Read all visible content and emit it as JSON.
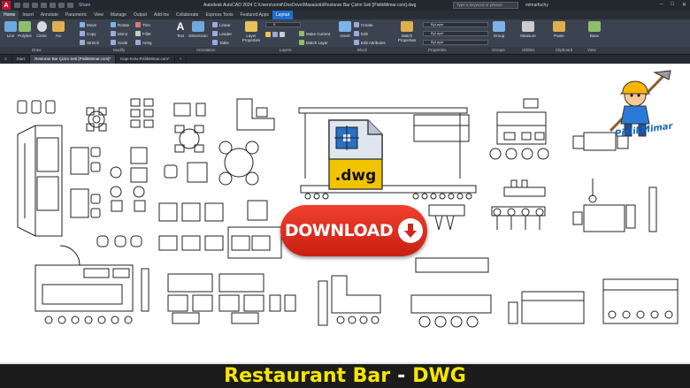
{
  "titlebar": {
    "app_letter": "A",
    "share": "Share",
    "title": "Autodesk AutoCAD 2024    C:\\Users\\cemil\\OneDrive\\Masaüstü\\Restoran Bar Çizim Seti [PislikMimar.com].dwg",
    "search_placeholder": "Type a keyword or phrase",
    "user": "mimarfuchy"
  },
  "tabs": [
    "Home",
    "Insert",
    "Annotate",
    "Parametric",
    "View",
    "Manage",
    "Output",
    "Add-ins",
    "Collaborate",
    "Express Tools",
    "Featured Apps",
    "Layout"
  ],
  "ribbon": {
    "draw": [
      "Line",
      "Polyline",
      "Circle",
      "Arc"
    ],
    "modify": [
      "Move",
      "Rotate",
      "Trim",
      "Copy",
      "Mirror",
      "Fillet",
      "Stretch",
      "Scale",
      "Array"
    ],
    "annotation": [
      "Text",
      "Dimension",
      "Linear",
      "Leader",
      "Table"
    ],
    "layers": [
      "Layer Properties",
      "Make Current",
      "Match Layer"
    ],
    "block": [
      "Insert",
      "Create",
      "Edit",
      "Edit Attributes"
    ],
    "properties": [
      "Match Properties",
      "ByLayer",
      "ByLayer",
      "ByLayer"
    ],
    "groups": "Group",
    "utilities": "Measure",
    "clipboard": "Paste",
    "view": "Base",
    "panel_labels": [
      "Draw",
      "Modify",
      "Annotation",
      "Layers",
      "Block",
      "Properties",
      "Groups",
      "Utilities",
      "Clipboard",
      "View"
    ]
  },
  "filetabs": {
    "menu": "≡",
    "start": "Start",
    "file1": "Restoran Bar Çizim Seti [PislikMimar.com]*",
    "file2": "Kapı-Kolu-PislikMimar.com*",
    "add": "+"
  },
  "overlay": {
    "dwg_label": ".dwg",
    "download_label": "DOWNLOAD",
    "mascot_text": "PislikMimar"
  },
  "banner": {
    "part1": "Restaurant Bar",
    "separator": "-",
    "part2": "DWG"
  },
  "colors": {
    "accent_blue": "#1d6fd1",
    "download_red": "#e0301f",
    "banner_yellow": "#f7e600"
  }
}
